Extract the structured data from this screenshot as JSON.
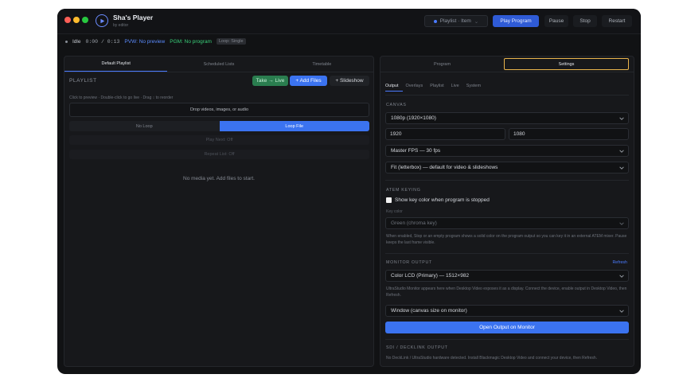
{
  "app": {
    "title": "Sha's Player",
    "subtitle": "by editor"
  },
  "toolbar": {
    "playlist_select": "Playlist · Item",
    "play_program": "Play Program",
    "pause": "Pause",
    "stop": "Stop",
    "restart": "Restart"
  },
  "status": {
    "state": "Idle",
    "time": "0:00 / 0:13",
    "pvw": "PVW: No preview",
    "pgm": "PGM: No program",
    "loop": "Loop: Single"
  },
  "left": {
    "tabs": [
      "Default Playlist",
      "Scheduled Lists",
      "Timetable"
    ],
    "playlist_heading": "PLAYLIST",
    "take_live": "Take → Live",
    "add_files": "+ Add Files",
    "slideshow": "+ Slideshow",
    "hint": "Click to preview · Double-click to go live · Drag ↕ to reorder",
    "drop_zone": "Drop videos, images, or audio",
    "loop_options": [
      "No Loop",
      "Loop File"
    ],
    "play_next": "Play Next: Off",
    "repeat_list": "Repeat List: Off",
    "empty": "No media yet. Add files to start."
  },
  "right": {
    "tabs": [
      "Program",
      "Settings"
    ],
    "subtabs": [
      "Output",
      "Overlays",
      "Playlist",
      "Live",
      "System"
    ],
    "canvas": {
      "heading": "CANVAS",
      "resolution": "1080p (1920×1080)",
      "width": "1920",
      "height": "1080",
      "fps": "Master FPS — 30 fps",
      "fit": "Fit (letterbox) — default for video & slideshows"
    },
    "atem": {
      "heading": "ATEM KEYING",
      "checkbox_label": "Show key color when program is stopped",
      "key_color_label": "Key color",
      "key_color": "Green (chroma key)",
      "desc": "When enabled, Stop or an empty program shows a solid color on the program output so you can key it in an external ATEM mixer. Pause keeps the last frame visible."
    },
    "monitor": {
      "heading": "MONITOR OUTPUT",
      "refresh": "Refresh",
      "display": "Color LCD (Primary) — 1512×982",
      "desc": "UltraStudio Monitor appears here when Desktop Video exposes it as a display. Connect the device, enable output in Desktop Video, then Refresh.",
      "mode": "Window (canvas size on monitor)",
      "open_button": "Open Output on Monitor"
    },
    "sdi": {
      "heading": "SDI / DECKLINK OUTPUT",
      "desc": "No DeckLink / UltraStudio hardware detected. Install Blackmagic Desktop Video and connect your device, then Refresh."
    }
  }
}
